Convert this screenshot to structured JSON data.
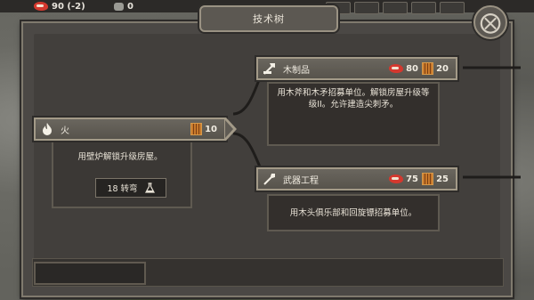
{
  "resources": {
    "food_value": "90 (-2)",
    "stone_value": "0"
  },
  "title": "技术树",
  "close_glyph": "⨂",
  "tree": {
    "root": {
      "label": "火",
      "icon": "flame-icon",
      "cost_wood": "10",
      "description": "用壁炉解锁升级房屋。",
      "turns_label": "18 转弯"
    },
    "children": [
      {
        "label": "木制品",
        "icon": "axe-icon",
        "cost_food": "80",
        "cost_wood": "20",
        "description": "用木斧和木矛招募单位。解锁房屋升级等级II。允许建造尖刺矛。"
      },
      {
        "label": "武器工程",
        "icon": "spear-icon",
        "cost_food": "75",
        "cost_wood": "25",
        "description": "用木头俱乐部和回旋镖招募单位。"
      }
    ]
  },
  "colors": {
    "panel": "#4b4845",
    "border": "#a39a88",
    "food_red": "#d4382e",
    "wood_orange": "#c97a2c"
  }
}
